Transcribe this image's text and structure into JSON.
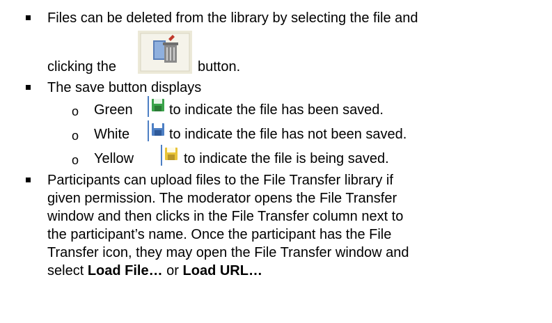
{
  "bullets": [
    {
      "line1": "Files can be deleted from the library by selecting the file and",
      "line2_before": "clicking the",
      "line2_after": "button.",
      "icon": "delete-file-icon"
    },
    {
      "text": "The save button displays",
      "sub": [
        {
          "marker": "o",
          "color_word": "Green",
          "text": "to indicate the file has been saved.",
          "icon": "save-green-icon",
          "icon_color": "#3aa34a"
        },
        {
          "marker": "o",
          "color_word": "White",
          "text": "to indicate the file has not been saved.",
          "icon": "save-white-icon",
          "icon_color": "#4d7fc4"
        },
        {
          "marker": "o",
          "color_word": "Yellow",
          "text": "to indicate the file is being saved.",
          "icon": "save-yellow-icon",
          "icon_color": "#e8c43a"
        }
      ]
    },
    {
      "lines": [
        "Participants can upload files to the File Transfer library if",
        "given permission.  The moderator opens the File Transfer",
        "window and then clicks in the File Transfer column next to",
        "the participant’s name. Once the participant  has the File",
        "Transfer icon, they may open the File Transfer window and"
      ],
      "last_line_before": "select ",
      "load_file": "Load File…",
      "last_line_mid": " or ",
      "load_url": "Load URL…"
    }
  ]
}
